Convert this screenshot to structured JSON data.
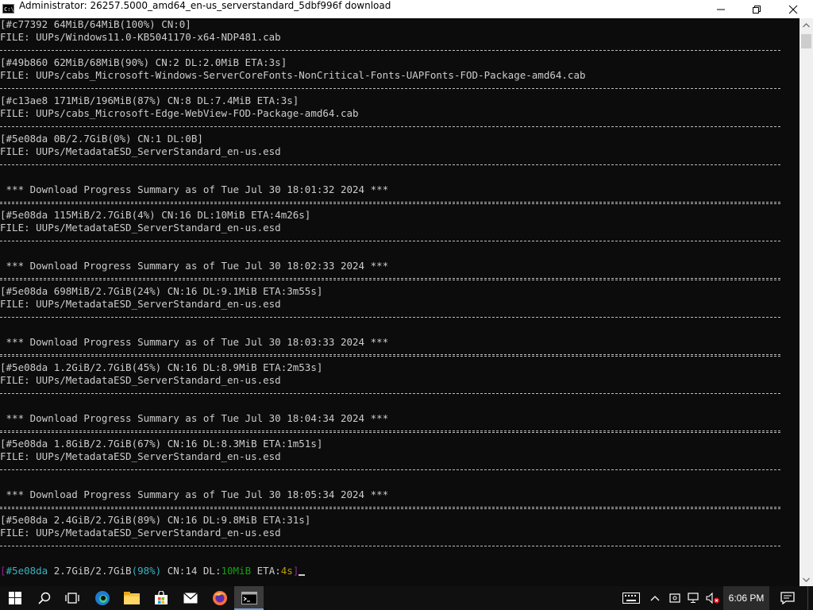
{
  "window": {
    "title": "Administrator:  26257.5000_amd64_en-us_serverstandard_5dbf996f download",
    "app_icon_text": "C:\\",
    "controls": [
      "minimize",
      "maximize",
      "close"
    ]
  },
  "console": {
    "lines": [
      "[#c77392 64MiB/64MiB(100%) CN:0]",
      "FILE: UUPs/Windows11.0-KB5041170-x64-NDP481.cab",
      "[#49b860 62MiB/68MiB(90%) CN:2 DL:2.0MiB ETA:3s]",
      "FILE: UUPs/cabs_Microsoft-Windows-ServerCoreFonts-NonCritical-Fonts-UAPFonts-FOD-Package-amd64.cab",
      "[#c13ae8 171MiB/196MiB(87%) CN:8 DL:7.4MiB ETA:3s]",
      "FILE: UUPs/cabs_Microsoft-Edge-WebView-FOD-Package-amd64.cab",
      "[#5e08da 0B/2.7GiB(0%) CN:1 DL:0B]",
      "FILE: UUPs/MetadataESD_ServerStandard_en-us.esd",
      " *** Download Progress Summary as of Tue Jul 30 18:01:32 2024 ***",
      "[#5e08da 115MiB/2.7GiB(4%) CN:16 DL:10MiB ETA:4m26s]",
      "FILE: UUPs/MetadataESD_ServerStandard_en-us.esd",
      " *** Download Progress Summary as of Tue Jul 30 18:02:33 2024 ***",
      "[#5e08da 698MiB/2.7GiB(24%) CN:16 DL:9.1MiB ETA:3m55s]",
      "FILE: UUPs/MetadataESD_ServerStandard_en-us.esd",
      " *** Download Progress Summary as of Tue Jul 30 18:03:33 2024 ***",
      "[#5e08da 1.2GiB/2.7GiB(45%) CN:16 DL:8.9MiB ETA:2m53s]",
      "FILE: UUPs/MetadataESD_ServerStandard_en-us.esd",
      " *** Download Progress Summary as of Tue Jul 30 18:04:34 2024 ***",
      "[#5e08da 1.8GiB/2.7GiB(67%) CN:16 DL:8.3MiB ETA:1m51s]",
      "FILE: UUPs/MetadataESD_ServerStandard_en-us.esd",
      " *** Download Progress Summary as of Tue Jul 30 18:05:34 2024 ***",
      "[#5e08da 2.4GiB/2.7GiB(89%) CN:16 DL:9.8MiB ETA:31s]",
      "FILE: UUPs/MetadataESD_ServerStandard_en-us.esd"
    ],
    "status_line": {
      "open_bracket": "[",
      "gid": "#5e08da",
      "progress": " 2.7GiB/2.7GiB",
      "percent": "(98%)",
      "cn": " CN:14 DL:",
      "speed": "10MiB",
      "eta_label": " ETA:",
      "eta": "4s",
      "close_bracket": "]"
    }
  },
  "taskbar": {
    "apps": [
      "start-icon",
      "search-icon",
      "task-view-icon",
      "edge-icon",
      "file-explorer-icon",
      "store-icon",
      "mail-icon",
      "firefox-icon",
      "command-prompt-icon"
    ],
    "tray": [
      "keyboard-icon",
      "chevron-up-icon",
      "meet-now-icon",
      "network-icon",
      "volume-muted-icon"
    ],
    "clock": "6:06 PM",
    "notification_icon": "action-center-icon"
  },
  "colors": {
    "console_bg": "#0c0c0c",
    "console_text": "#cccccc",
    "gid": "#3ab1bf",
    "percent": "#3ab1bf",
    "speed": "#13a10e",
    "eta": "#c19c00",
    "bracket": "#8a2a8a"
  }
}
